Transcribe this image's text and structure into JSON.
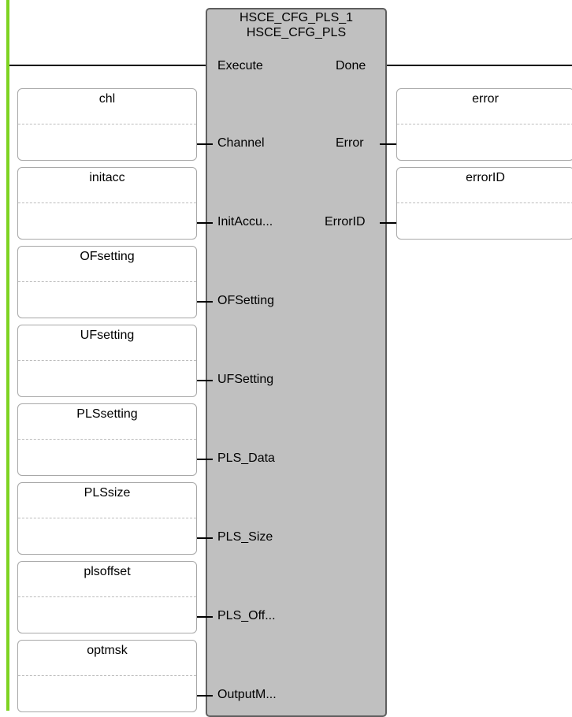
{
  "block": {
    "instance_name": "HSCE_CFG_PLS_1",
    "type_name": "HSCE_CFG_PLS",
    "inputs": [
      "Execute",
      "Channel",
      "InitAccu...",
      "OFSetting",
      "UFSetting",
      "PLS_Data",
      "PLS_Size",
      "PLS_Off...",
      "OutputM..."
    ],
    "outputs": [
      "Done",
      "Error",
      "ErrorID"
    ]
  },
  "input_variables": [
    "chl",
    "initacc",
    "OFsetting",
    "UFsetting",
    "PLSsetting",
    "PLSsize",
    "plsoffset",
    "optmsk"
  ],
  "output_variables": [
    "error",
    "errorID"
  ],
  "colors": {
    "rail": "#7ed321",
    "block_fill": "#c0c0c0",
    "block_border": "#5f5f5f",
    "var_border": "#a8a8a8"
  }
}
